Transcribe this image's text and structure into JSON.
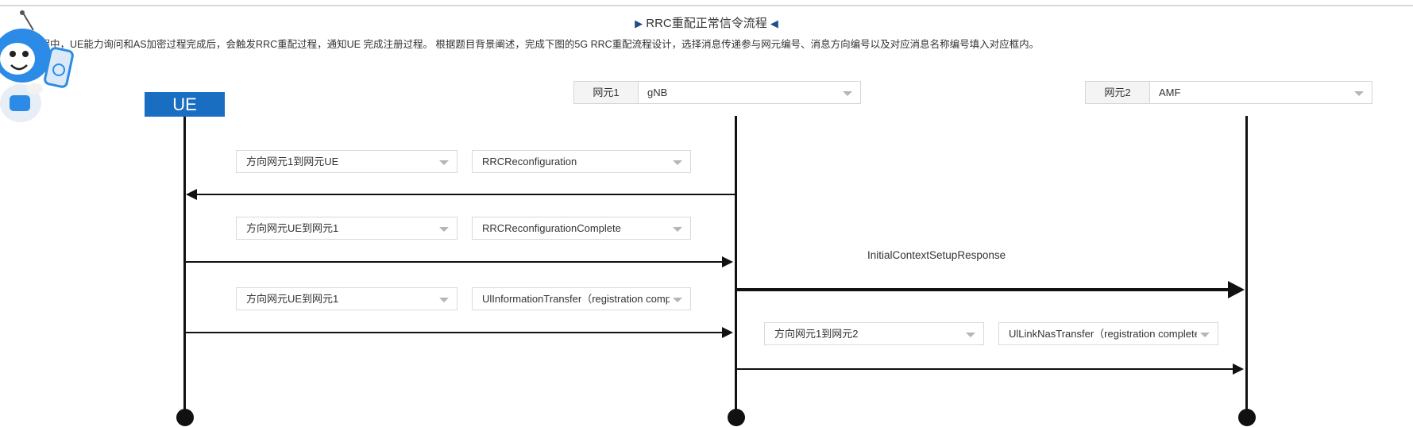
{
  "header": {
    "title_left_icon": "right-triangle-icon",
    "title": "RRC重配正常信令流程",
    "title_right_icon": "left-triangle-icon",
    "description": "过程中，UE能力询问和AS加密过程完成后，会触发RRC重配过程，通知UE 完成注册过程。 根据题目背景阐述，完成下图的5G RRC重配流程设计，选择消息传递参与网元编号、消息方向编号以及对应消息名称编号填入对应框内。"
  },
  "mascot": {
    "icon": "robot-mascot-icon"
  },
  "entities": {
    "ue": {
      "label": "UE"
    },
    "ne1": {
      "label": "网元1",
      "value": "gNB"
    },
    "ne2": {
      "label": "网元2",
      "value": "AMF"
    }
  },
  "rows": [
    {
      "direction": "方向网元1到网元UE",
      "message": "RRCReconfiguration"
    },
    {
      "direction": "方向网元UE到网元1",
      "message": "RRCReconfigurationComplete"
    },
    {
      "direction": "方向网元UE到网元1",
      "message": "UlInformationTransfer（registration complete）"
    },
    {
      "direction": "方向网元1到网元2",
      "message": "UlLinkNasTransfer（registration complete）"
    }
  ],
  "labels": {
    "initial_context": "InitialContextSetupResponse"
  },
  "colors": {
    "accent": "#1a6ec2",
    "line": "#111111",
    "title_triangle": "#1f4e8c"
  }
}
